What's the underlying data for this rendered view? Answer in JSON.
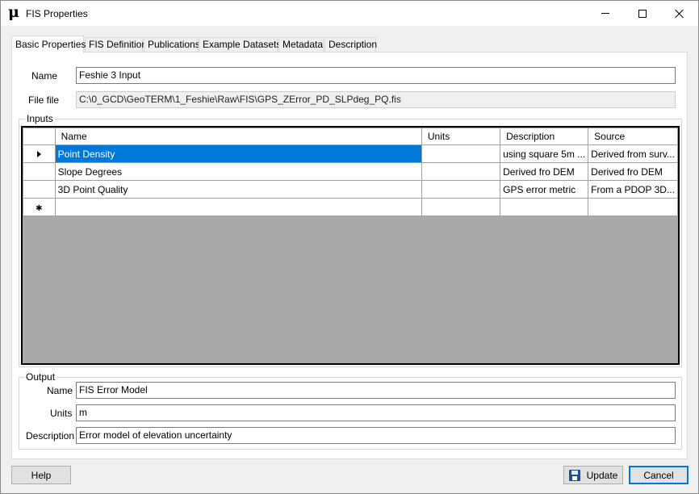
{
  "window": {
    "icon_glyph": "μ",
    "title": "FIS Properties"
  },
  "tabs": [
    {
      "label": "Basic Properties",
      "active": true
    },
    {
      "label": "FIS Definition"
    },
    {
      "label": "Publications"
    },
    {
      "label": "Example Datasets"
    },
    {
      "label": "Metadata"
    },
    {
      "label": "Description"
    }
  ],
  "basic": {
    "name_label": "Name",
    "name_value": "Feshie 3 Input",
    "file_label": "File file",
    "file_value": "C:\\0_GCD\\GeoTERM\\1_Feshie\\Raw\\FIS\\GPS_ZError_PD_SLPdeg_PQ.fis"
  },
  "inputs": {
    "group_title": "Inputs",
    "columns": [
      "Name",
      "Units",
      "Description",
      "Source"
    ],
    "rows": [
      {
        "name": "Point Density",
        "units": "",
        "description": "using square 5m ...",
        "source": "Derived from surv..."
      },
      {
        "name": "Slope Degrees",
        "units": "",
        "description": "Derived fro DEM",
        "source": "Derived fro DEM"
      },
      {
        "name": "3D Point Quality",
        "units": "",
        "description": "GPS error metric",
        "source": "From a PDOP 3D..."
      }
    ],
    "new_row_glyph": "✱"
  },
  "output": {
    "group_title": "Output",
    "name_label": "Name",
    "name_value": "FIS Error Model",
    "units_label": "Units",
    "units_value": "m",
    "description_label": "Description",
    "description_value": "Error model of elevation uncertainty"
  },
  "buttons": {
    "help": "Help",
    "update": "Update",
    "cancel": "Cancel"
  },
  "colors": {
    "selection": "#0078d7",
    "grid_background": "#a9a9a9",
    "window_background": "#f0f0f0"
  }
}
